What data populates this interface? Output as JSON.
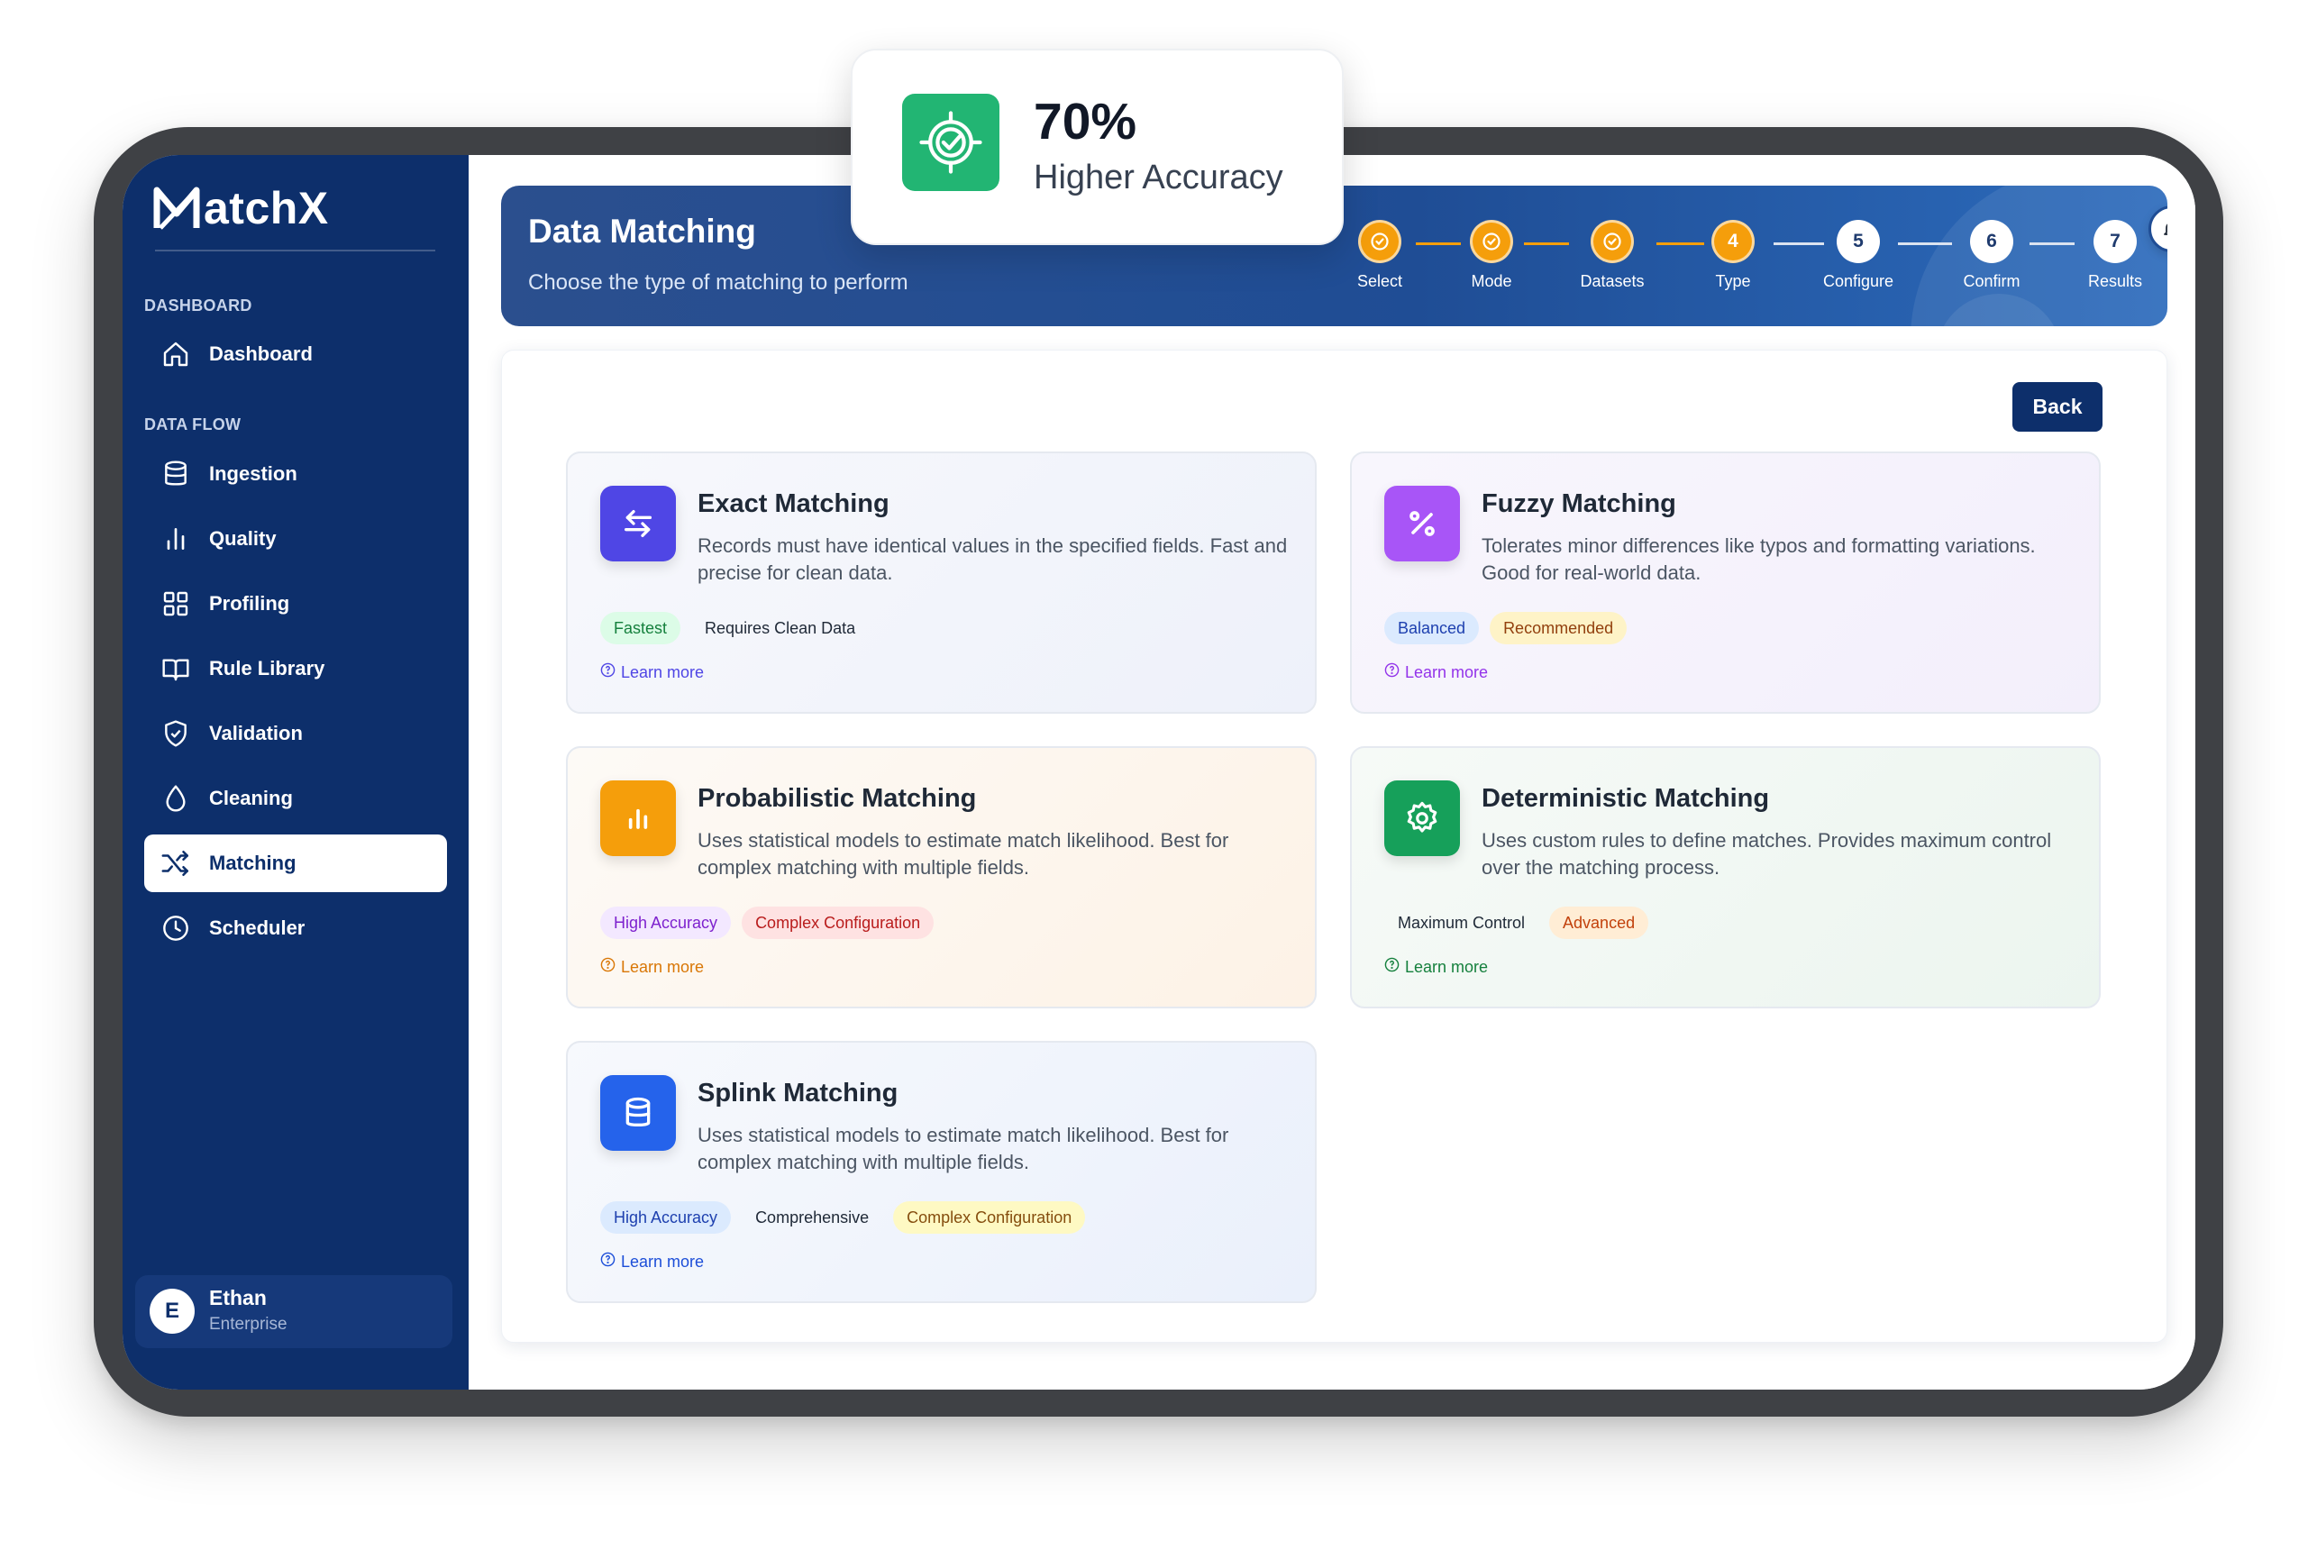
{
  "brand": {
    "name": "atchX"
  },
  "sidebar": {
    "sections": [
      {
        "label": "DASHBOARD"
      },
      {
        "label": "DATA FLOW"
      }
    ],
    "items": [
      {
        "label": "Dashboard",
        "icon": "home-icon"
      },
      {
        "label": "Ingestion",
        "icon": "database-icon"
      },
      {
        "label": "Quality",
        "icon": "bar-chart-icon"
      },
      {
        "label": "Profiling",
        "icon": "grid-icon"
      },
      {
        "label": "Rule Library",
        "icon": "book-icon"
      },
      {
        "label": "Validation",
        "icon": "shield-check-icon"
      },
      {
        "label": "Cleaning",
        "icon": "droplet-icon"
      },
      {
        "label": "Matching",
        "icon": "shuffle-icon",
        "active": true
      },
      {
        "label": "Scheduler",
        "icon": "clock-icon"
      }
    ],
    "user": {
      "initial": "E",
      "name": "Ethan",
      "plan": "Enterprise"
    }
  },
  "header": {
    "title": "Data Matching",
    "subtitle": "Choose the type of matching to perform",
    "steps": [
      {
        "label": "Select",
        "status": "done"
      },
      {
        "label": "Mode",
        "status": "done"
      },
      {
        "label": "Datasets",
        "status": "done"
      },
      {
        "label": "Type",
        "number": "4",
        "status": "current"
      },
      {
        "label": "Configure",
        "number": "5",
        "status": "todo"
      },
      {
        "label": "Confirm",
        "number": "6",
        "status": "todo"
      },
      {
        "label": "Results",
        "number": "7",
        "status": "todo"
      }
    ]
  },
  "actions": {
    "back_label": "Back"
  },
  "cards": [
    {
      "title": "Exact Matching",
      "description": "Records must have identical values in the specified fields. Fast and precise for clean data.",
      "icon": "swap-arrows-icon",
      "icon_color": "#4f46e5",
      "tags": [
        {
          "label": "Fastest",
          "style": "green"
        },
        {
          "label": "Requires Clean Data",
          "style": "plain"
        }
      ],
      "learn_more": "Learn more",
      "link_color": "#4f46e5"
    },
    {
      "title": "Fuzzy Matching",
      "description": "Tolerates minor differences like typos and formatting variations. Good for real-world data.",
      "icon": "percent-icon",
      "icon_color": "#a855f7",
      "tags": [
        {
          "label": "Balanced",
          "style": "blue"
        },
        {
          "label": "Recommended",
          "style": "yellow"
        }
      ],
      "learn_more": "Learn more",
      "link_color": "#9333ea"
    },
    {
      "title": "Probabilistic Matching",
      "description": "Uses statistical models to estimate match likelihood. Best for complex matching with multiple fields.",
      "icon": "bar-chart-icon",
      "icon_color": "#f59e0b",
      "tags": [
        {
          "label": "High Accuracy",
          "style": "purple"
        },
        {
          "label": "Complex Configuration",
          "style": "red"
        }
      ],
      "learn_more": "Learn more",
      "link_color": "#d97706"
    },
    {
      "title": "Deterministic Matching",
      "description": "Uses custom rules to define matches. Provides maximum control over the matching process.",
      "icon": "gear-icon",
      "icon_color": "#16a05a",
      "tags": [
        {
          "label": "Maximum Control",
          "style": "plain"
        },
        {
          "label": "Advanced",
          "style": "orange"
        }
      ],
      "learn_more": "Learn more",
      "link_color": "#15803d"
    },
    {
      "title": "Splink Matching",
      "description": "Uses statistical models to estimate match likelihood. Best for complex matching with multiple fields.",
      "icon": "database-icon",
      "icon_color": "#2563eb",
      "tags": [
        {
          "label": "High Accuracy",
          "style": "blue"
        },
        {
          "label": "Comprehensive",
          "style": "plain"
        },
        {
          "label": "Complex Configuration",
          "style": "yellow"
        }
      ],
      "learn_more": "Learn more",
      "link_color": "#1d4ed8"
    }
  ],
  "badge": {
    "value": "70%",
    "label": "Higher Accuracy",
    "icon": "target-check-icon",
    "color": "#22b573"
  },
  "colors": {
    "sidebar": "#0d2f6b",
    "accent": "#f59e0b",
    "primary": "#0d2f6b"
  }
}
